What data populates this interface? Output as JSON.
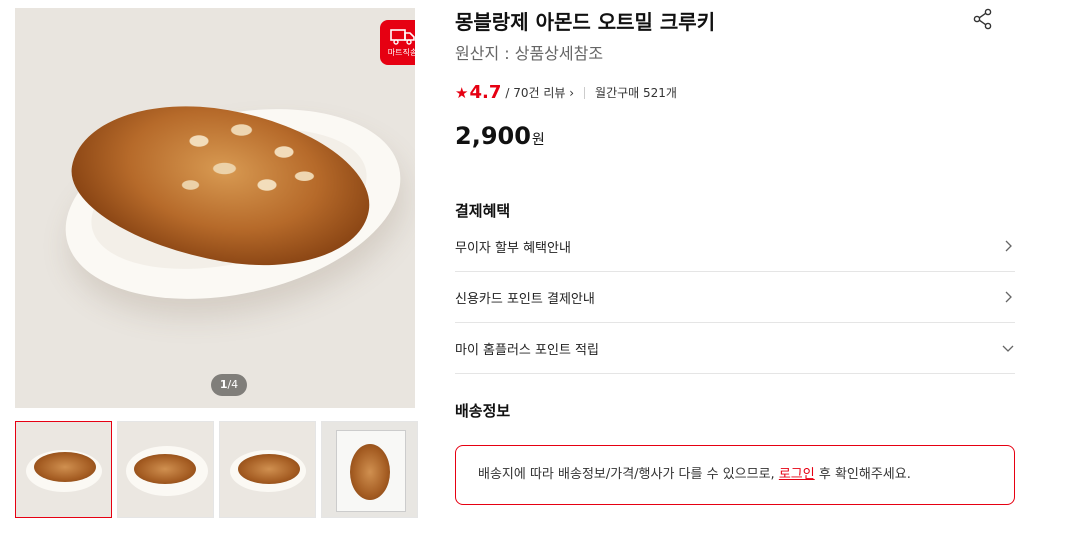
{
  "product": {
    "title": "몽블랑제 아몬드 오트밀 크루키",
    "origin": "원산지 : 상품상세참조",
    "rating_star": "★",
    "rating_score": "4.7",
    "review_count": "/ 70건 리뷰",
    "review_chevron": "›",
    "monthly_purchases": "월간구매 521개",
    "price_value": "2,900",
    "price_unit": "원"
  },
  "gallery": {
    "badge_label": "마트직송",
    "counter_current": "1",
    "counter_total": "/4",
    "thumbnails": [
      "thumb-1",
      "thumb-2",
      "thumb-3",
      "thumb-4"
    ]
  },
  "payment": {
    "title": "결제혜택",
    "items": [
      {
        "label": "무이자 할부 혜택안내",
        "icon": "chevron-right-icon"
      },
      {
        "label": "신용카드 포인트 결제안내",
        "icon": "chevron-right-icon"
      },
      {
        "label": "마이 홈플러스 포인트 적립",
        "icon": "chevron-down-icon"
      }
    ]
  },
  "delivery": {
    "title": "배송정보",
    "notice_before": "배송지에 따라 배송정보/가격/행사가 다를 수 있으므로,",
    "notice_link": "로그인",
    "notice_after": "후 확인해주세요."
  },
  "colors": {
    "accent": "#e60012",
    "text": "#111111",
    "muted": "#666666",
    "border": "#e5e5e5"
  }
}
